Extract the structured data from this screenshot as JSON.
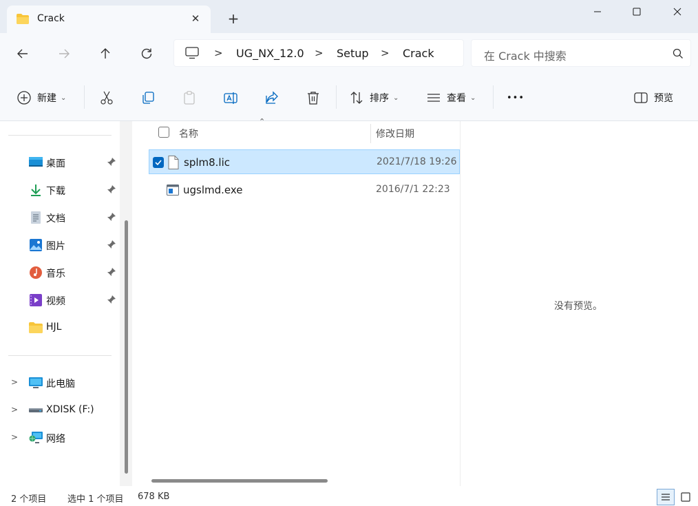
{
  "window": {
    "tab_title": "Crack",
    "close_glyph": "✕",
    "new_tab_glyph": "+"
  },
  "address": {
    "segments": [
      "UG_NX_12.0",
      "Setup",
      "Crack"
    ],
    "separator": ">"
  },
  "search": {
    "placeholder": "在 Crack 中搜索"
  },
  "toolbar": {
    "new_label": "新建",
    "sort_label": "排序",
    "view_label": "查看",
    "more_glyph": "•••",
    "preview_label": "预览"
  },
  "sidebar": {
    "quick_access": [
      {
        "label": "桌面",
        "icon": "desktop-icon",
        "pinned": true
      },
      {
        "label": "下载",
        "icon": "download-icon",
        "pinned": true
      },
      {
        "label": "文档",
        "icon": "documents-icon",
        "pinned": true
      },
      {
        "label": "图片",
        "icon": "pictures-icon",
        "pinned": true
      },
      {
        "label": "音乐",
        "icon": "music-icon",
        "pinned": true
      },
      {
        "label": "视频",
        "icon": "videos-icon",
        "pinned": true
      },
      {
        "label": "HJL",
        "icon": "folder-icon",
        "pinned": false
      }
    ],
    "locations": [
      {
        "label": "此电脑",
        "icon": "computer-icon"
      },
      {
        "label": "XDISK (F:)",
        "icon": "drive-icon"
      },
      {
        "label": "网络",
        "icon": "network-icon"
      }
    ],
    "chevron_glyph": ">"
  },
  "files": {
    "columns": {
      "name": "名称",
      "modified": "修改日期"
    },
    "rows": [
      {
        "name": "splm8.lic",
        "modified": "2021/7/18 19:26",
        "selected": true,
        "icon": "text-file-icon"
      },
      {
        "name": "ugslmd.exe",
        "modified": "2016/7/1 22:23",
        "selected": false,
        "icon": "exe-file-icon"
      }
    ]
  },
  "preview": {
    "empty_text": "没有预览。"
  },
  "status": {
    "item_count": "2 个项目",
    "selection": "选中 1 个项目",
    "size": "678 KB"
  },
  "colors": {
    "accent": "#0067c0",
    "selection_bg": "#cce8ff",
    "selection_border": "#99d1ff",
    "folder": "#f8c53a"
  }
}
